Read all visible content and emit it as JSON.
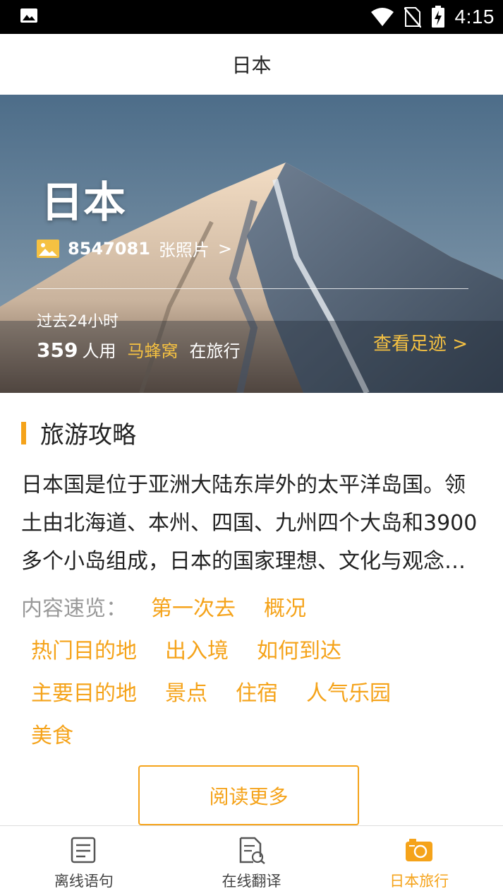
{
  "status_bar": {
    "time": "4:15"
  },
  "header": {
    "title": "日本"
  },
  "hero": {
    "title": "日本",
    "photo_count": "8547081",
    "photo_suffix": "张照片",
    "chevron": ">",
    "past_label": "过去24小时",
    "user_count": "359",
    "users_text": "人用",
    "app_name": "马蜂窝",
    "traveling_text": "在旅行",
    "footprint_link": "查看足迹 >"
  },
  "guide": {
    "section_title": "旅游攻略",
    "intro": "日本国是位于亚洲大陆东岸外的太平洋岛国。领土由北海道、本州、四国、九州四个大岛和3900多个小岛组成，日本的国家理想、文化与观念受到中国的深刻影响。",
    "quick_label": "内容速览：",
    "tags": [
      "第一次去",
      "概况",
      "热门目的地",
      "出入境",
      "如何到达",
      "主要目的地",
      "景点",
      "住宿",
      "人气乐园",
      "美食"
    ],
    "read_more": "阅读更多"
  },
  "tabbar": {
    "items": [
      {
        "label": "离线语句",
        "icon": "phrasebook-icon",
        "active": false
      },
      {
        "label": "在线翻译",
        "icon": "translate-doc-icon",
        "active": false
      },
      {
        "label": "日本旅行",
        "icon": "camera-icon",
        "active": true
      }
    ]
  },
  "colors": {
    "accent": "#f5a31a",
    "hero_highlight": "#f5c142"
  }
}
